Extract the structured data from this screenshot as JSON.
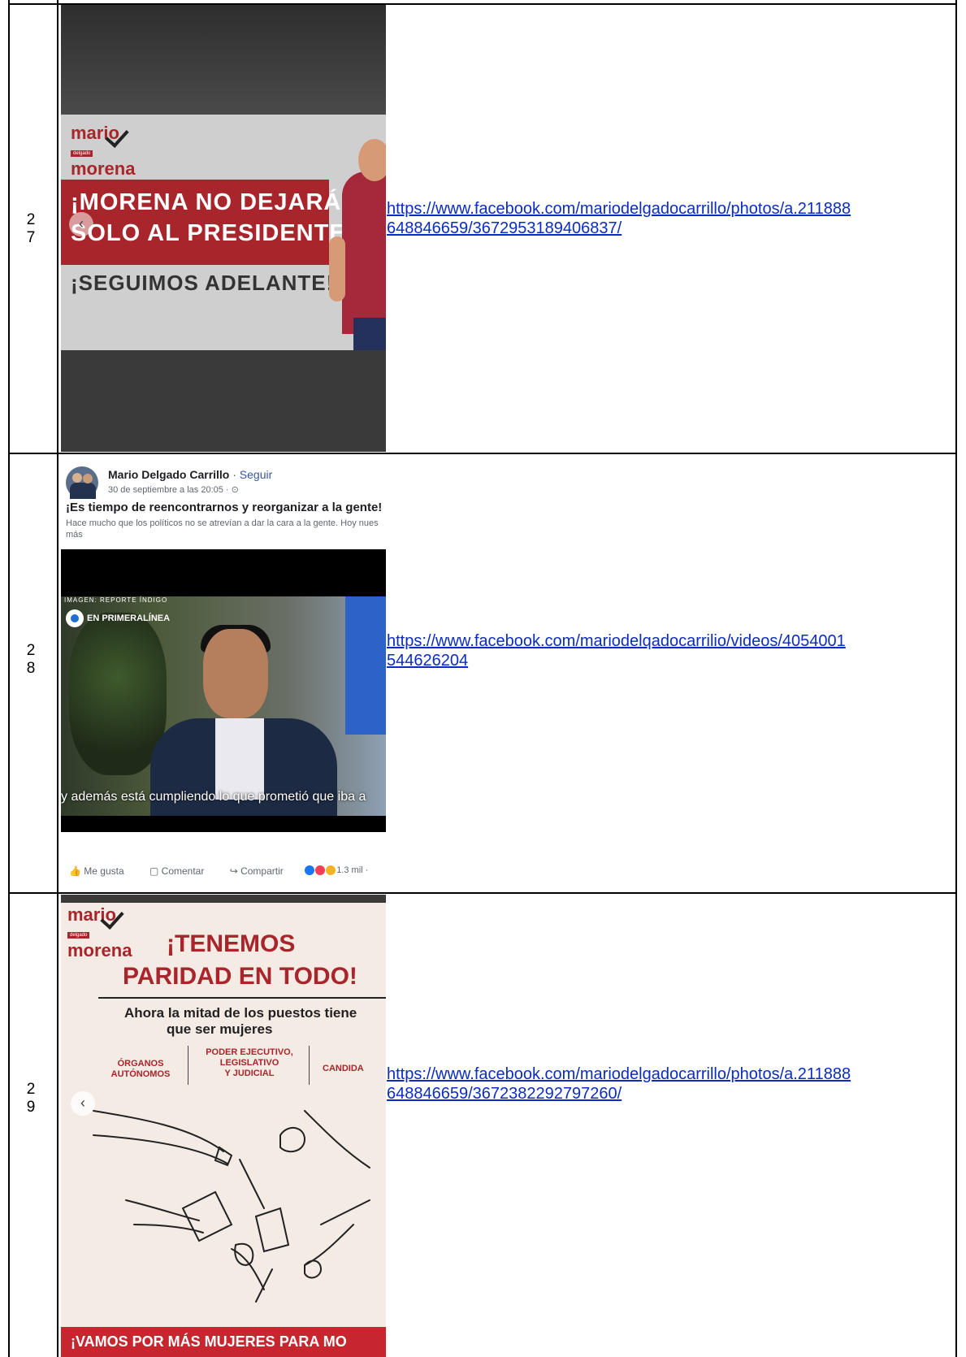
{
  "rows": [
    {
      "number_line1": "2",
      "number_line2": "7",
      "link_line1": "https://www.facebook.com/mariodelgadocarrillo/photos/a.211888",
      "link_line2": "648846659/3672953189406837/",
      "image": {
        "logo_top": "mario",
        "logo_tag": "delgado",
        "logo_bottom": "morena",
        "headline_line1": "¡MORENA NO DEJARÁ",
        "headline_line2": "SOLO AL PRESIDENTE!",
        "headline_line3": "¡SEGUIMOS ADELANTE!",
        "prev_arrow": "‹"
      }
    },
    {
      "number_line1": "2",
      "number_line2": "8",
      "link_line1": "https://www.facebook.com/mariodelqadocarrilio/videos/4054001",
      "link_line2": "544626204",
      "image": {
        "author": "Mario Delgado Carrillo",
        "follow": "· Seguir",
        "date": "30 de septiembre a las 20:05 · ⊙",
        "title": "¡Es tiempo de reencontrarnos y reorganizar a la gente!",
        "description": "Hace mucho que los políticos no se atrevían a dar la cara a la gente. Hoy nues",
        "more": "más",
        "video_overlay_small": "IMAGEN: REPORTE ÍNDIGO",
        "video_brand": "EN PRIMERALÍNEA",
        "caption": "y además está cumpliendo lo que prometió que iba a",
        "action_like": "Me gusta",
        "action_comment": "Comentar",
        "action_share": "Compartir",
        "reactions_count": "1.3 mil ·"
      }
    },
    {
      "number_line1": "2",
      "number_line2": "9",
      "link_line1": "https://www.facebook.com/mariodelgadocarrillo/photos/a.211888",
      "link_line2": "648846659/3672382292797260/",
      "image": {
        "logo_top": "mario",
        "logo_tag": "delgado",
        "logo_bottom": "morena",
        "headline_line1": "¡TENEMOS",
        "headline_line2": "PARIDAD EN TODO!",
        "sub_line1": "Ahora la mitad de los puestos tiene",
        "sub_line2": "que ser mujeres",
        "cat1_line1": "ÓRGANOS",
        "cat1_line2": "AUTÓNOMOS",
        "cat2_line1": "PODER EJECUTIVO,",
        "cat2_line2": "LEGISLATIVO",
        "cat2_line3": "Y JUDICIAL",
        "cat3": "CANDIDA",
        "prev_arrow": "‹",
        "bottom_banner": "¡VAMOS POR MÁS MUJERES PARA MO"
      }
    }
  ],
  "colors": {
    "link": "#0b2cc2",
    "morena_red": "#a8252b",
    "banner_red": "#c8262e"
  }
}
